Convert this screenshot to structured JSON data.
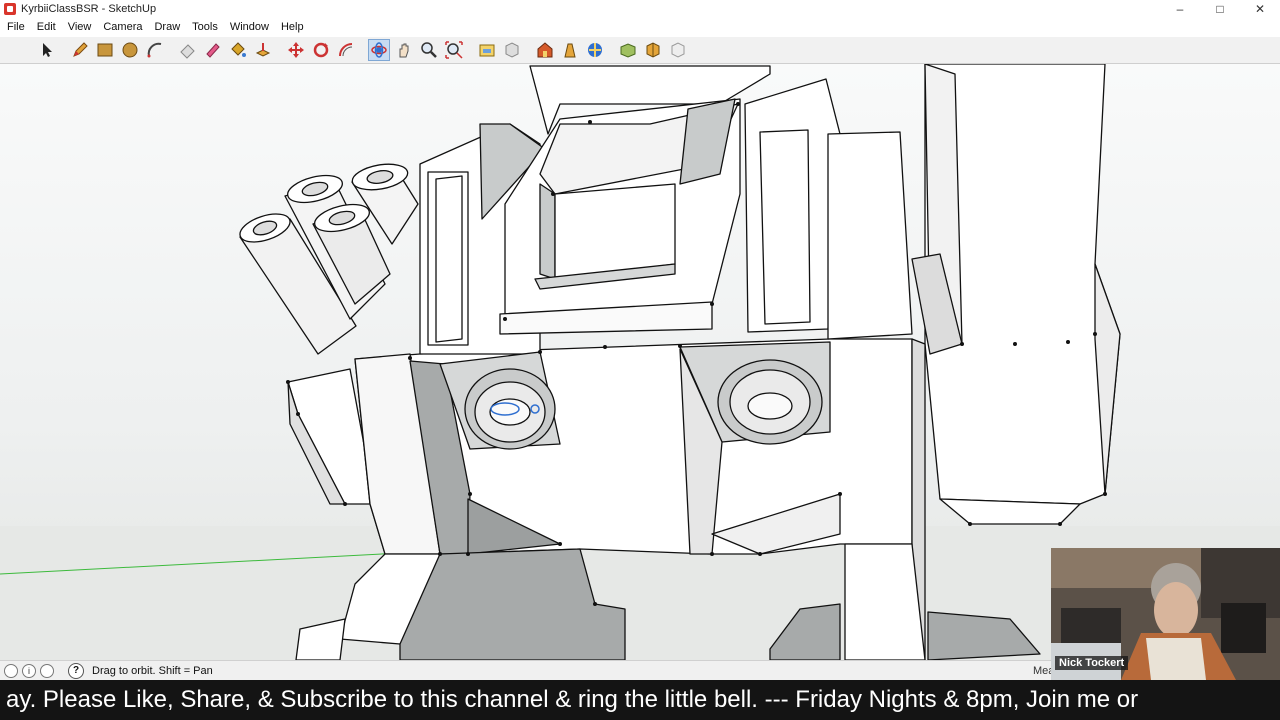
{
  "window": {
    "title": "KyrbiiClassBSR - SketchUp",
    "controls": {
      "minimize": "–",
      "maximize": "□",
      "close": "✕"
    }
  },
  "menu": {
    "items": [
      {
        "label": "File"
      },
      {
        "label": "Edit"
      },
      {
        "label": "View"
      },
      {
        "label": "Camera"
      },
      {
        "label": "Draw"
      },
      {
        "label": "Tools"
      },
      {
        "label": "Window"
      },
      {
        "label": "Help"
      }
    ]
  },
  "toolbar": {
    "active_tool": "orbit-icon",
    "tools": [
      "select-icon",
      "pencil-icon",
      "rectangle-icon",
      "circle-icon",
      "arc-icon",
      "eraser-icon",
      "tape-icon",
      "paint-bucket-icon",
      "push-pull-icon",
      "move-icon",
      "rotate-icon",
      "offset-icon",
      "orbit-icon",
      "pan-icon",
      "zoom-icon",
      "zoom-extents-icon",
      "previous-view-icon",
      "next-view-icon",
      "warehouse-icon",
      "extension-icon",
      "share-icon",
      "component-icon",
      "layout-icon",
      "export-icon"
    ]
  },
  "colors": {
    "model_face": "#ffffff",
    "model_shade": "#c9cbcb",
    "model_dark_shade": "#9fa2a2",
    "edge": "#111111",
    "selection_blue": "#2f6fd0",
    "green_axis": "#3cba3c",
    "ticker_bg": "#141414"
  },
  "status": {
    "text": "Drag to orbit.  Shift = Pan",
    "measurements_label": "Mea"
  },
  "webcam": {
    "name": "Nick Tockert"
  },
  "ticker": {
    "text": "ay. Please Like, Share, & Subscribe to this channel & ring the little bell. --- Friday Nights & 8pm, Join me or"
  }
}
